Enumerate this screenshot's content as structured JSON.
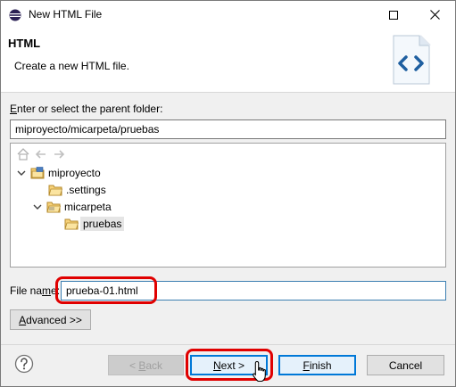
{
  "window": {
    "title": "New HTML File"
  },
  "banner": {
    "title": "HTML",
    "description": "Create a new HTML file."
  },
  "folder": {
    "label_prefix": "",
    "label_underlined": "E",
    "label_rest": "nter or select the parent folder:",
    "value": "miproyecto/micarpeta/pruebas"
  },
  "tree": {
    "items": [
      {
        "label": "miproyecto",
        "expanded": true,
        "icon": "project-icon"
      },
      {
        "label": ".settings",
        "icon": "folder-icon"
      },
      {
        "label": "micarpeta",
        "expanded": true,
        "icon": "folder-icon"
      },
      {
        "label": "pruebas",
        "selected": true,
        "icon": "folder-icon"
      }
    ]
  },
  "filename": {
    "label_prefix": "File na",
    "label_underlined": "m",
    "label_rest": "e:",
    "value": "prueba-01.html"
  },
  "buttons": {
    "advanced_underlined": "A",
    "advanced_rest": "dvanced >>",
    "back_prefix": "< ",
    "back_underlined": "B",
    "back_rest": "ack",
    "next_underlined": "N",
    "next_rest": "ext >",
    "finish_underlined": "F",
    "finish_rest": "inish",
    "cancel": "Cancel"
  },
  "colors": {
    "highlight_ring": "#e00000",
    "default_button_border": "#0078d7"
  }
}
